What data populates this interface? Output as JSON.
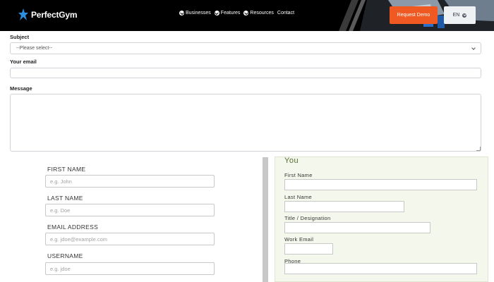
{
  "header": {
    "brand": "PerfectGym",
    "nav": [
      {
        "label": "Businesses"
      },
      {
        "label": "Features"
      },
      {
        "label": "Resources"
      },
      {
        "label": "Contact"
      }
    ],
    "demo_label": "Request Demo",
    "lang_label": "EN"
  },
  "contact_form": {
    "subject_label": "Subject",
    "subject_selected": "--Please select--",
    "email_label": "Your email",
    "message_label": "Message"
  },
  "signup_form": {
    "first_name_label": "FIRST NAME",
    "first_name_placeholder": "e.g. John",
    "last_name_label": "LAST NAME",
    "last_name_placeholder": "e.g. Doe",
    "email_label": "EMAIL ADDRESS",
    "email_placeholder": "e.g. jdoe@example.com",
    "username_label": "USERNAME",
    "username_placeholder": "e.g. jdoe"
  },
  "you_form": {
    "title": "You",
    "first_name_label": "First Name",
    "last_name_label": "Last Name",
    "title_label": "Title / Designation",
    "work_email_label": "Work Email",
    "phone_label": "Phone"
  },
  "colors": {
    "header_bg": "#000000",
    "accent_orange": "#f05a22",
    "logo_blue": "#2a8fe0",
    "panel_green_bg": "#f4f8ec",
    "panel_title": "#556b2f"
  },
  "icons": [
    "logo-star-icon",
    "chevron-down-icon"
  ]
}
